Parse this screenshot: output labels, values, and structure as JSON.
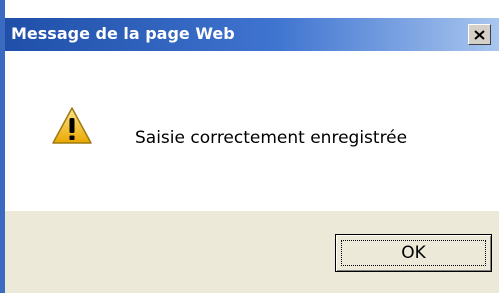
{
  "dialog": {
    "title": "Message de la page Web",
    "close_label": "X",
    "icon": "warning-icon",
    "message": "Saisie correctement enregistrée",
    "ok_label": "OK",
    "colors": {
      "title_bar_start": "#1f4fa8",
      "title_bar_end": "#a9c6ef",
      "footer_bg": "#ece9d8",
      "warning_yellow": "#f5c211"
    }
  }
}
